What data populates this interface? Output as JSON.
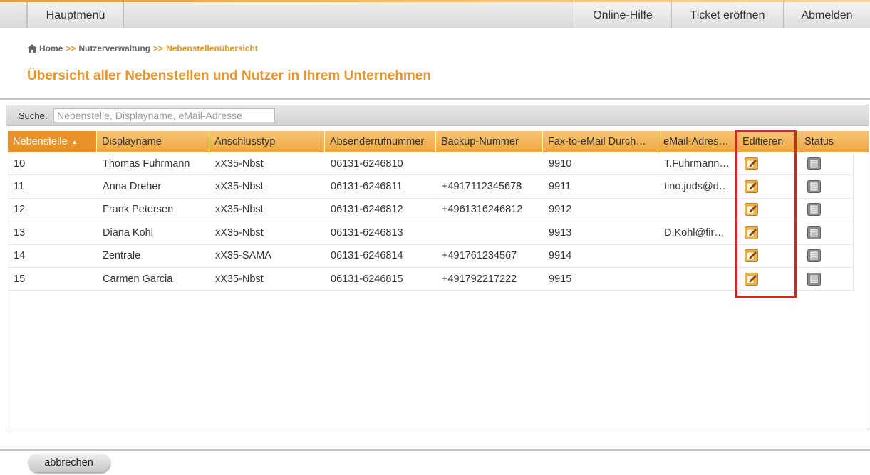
{
  "nav": {
    "main_menu": "Hauptmenü",
    "help": "Online-Hilfe",
    "ticket": "Ticket eröffnen",
    "logout": "Abmelden"
  },
  "breadcrumb": {
    "home": "Home",
    "separator": ">>",
    "section": "Nutzerverwaltung",
    "current": "Nebenstellenübersicht"
  },
  "page_title": "Übersicht aller Nebenstellen und Nutzer in Ihrem Unternehmen",
  "search": {
    "label": "Suche:",
    "placeholder": "Nebenstelle, Displayname, eMail-Adresse",
    "value": ""
  },
  "table": {
    "columns": [
      "Nebenstelle",
      "Displayname",
      "Anschlusstyp",
      "Absenderrufnummer",
      "Backup-Nummer",
      "Fax-to-eMail Durch…",
      "eMail-Adres…",
      "Editieren",
      "Status"
    ],
    "sorted_column": "Nebenstelle",
    "rows": [
      {
        "ext": "10",
        "name": "Thomas Fuhrmann",
        "type": "xX35-Nbst",
        "sender": "06131-6246810",
        "backup": "",
        "fax": "9910",
        "email": "T.Fuhrmann…"
      },
      {
        "ext": "11",
        "name": "Anna Dreher",
        "type": "xX35-Nbst",
        "sender": "06131-6246811",
        "backup": "+4917112345678",
        "fax": "9911",
        "email": "tino.juds@d…"
      },
      {
        "ext": "12",
        "name": "Frank Petersen",
        "type": "xX35-Nbst",
        "sender": "06131-6246812",
        "backup": "+4961316246812",
        "fax": "9912",
        "email": ""
      },
      {
        "ext": "13",
        "name": "Diana Kohl",
        "type": "xX35-Nbst",
        "sender": "06131-6246813",
        "backup": "",
        "fax": "9913",
        "email": "D.Kohl@fir…"
      },
      {
        "ext": "14",
        "name": "Zentrale",
        "type": "xX35-SAMA",
        "sender": "06131-6246814",
        "backup": "+491761234567",
        "fax": "9914",
        "email": ""
      },
      {
        "ext": "15",
        "name": "Carmen Garcia",
        "type": "xX35-Nbst",
        "sender": "06131-6246815",
        "backup": "+491792217222",
        "fax": "9915",
        "email": ""
      }
    ]
  },
  "footer": {
    "cancel_label": "abbrechen"
  },
  "colors": {
    "accent": "#e8952a",
    "header_orange": "#efa83f",
    "highlight": "#e02020"
  }
}
